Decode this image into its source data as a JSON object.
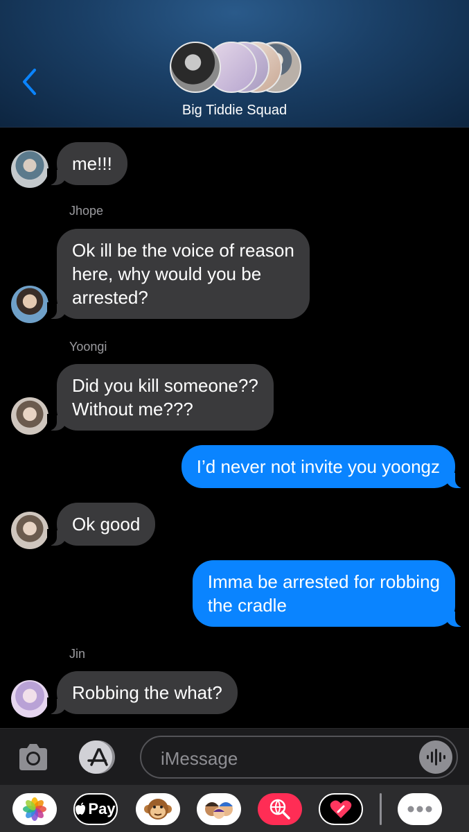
{
  "header": {
    "group_name": "Big Tiddie Squad"
  },
  "messages": [
    {
      "id": "m1",
      "direction": "incoming",
      "sender": "",
      "text": "me!!!"
    },
    {
      "id": "m2",
      "direction": "incoming",
      "sender": "Jhope",
      "lines": [
        "Ok ill be the voice of reason",
        "here, why would you be",
        "arrested?"
      ]
    },
    {
      "id": "m3",
      "direction": "incoming",
      "sender": "Yoongi",
      "lines": [
        "Did you kill someone??",
        "Without me???"
      ]
    },
    {
      "id": "m4",
      "direction": "outgoing",
      "text": "I’d never not invite you yoongz"
    },
    {
      "id": "m5",
      "direction": "incoming",
      "sender": "",
      "text": "Ok good"
    },
    {
      "id": "m6",
      "direction": "outgoing",
      "lines": [
        "Imma be arrested for robbing",
        "the cradle"
      ]
    },
    {
      "id": "m7",
      "direction": "incoming",
      "sender": "Jin",
      "text": "Robbing the what?"
    }
  ],
  "input": {
    "placeholder": "iMessage"
  },
  "apps": {
    "pay_label": "Pay"
  },
  "colors": {
    "incoming_bubble": "#3a3a3c",
    "outgoing_bubble": "#0a84ff",
    "accent": "#0a84ff"
  }
}
